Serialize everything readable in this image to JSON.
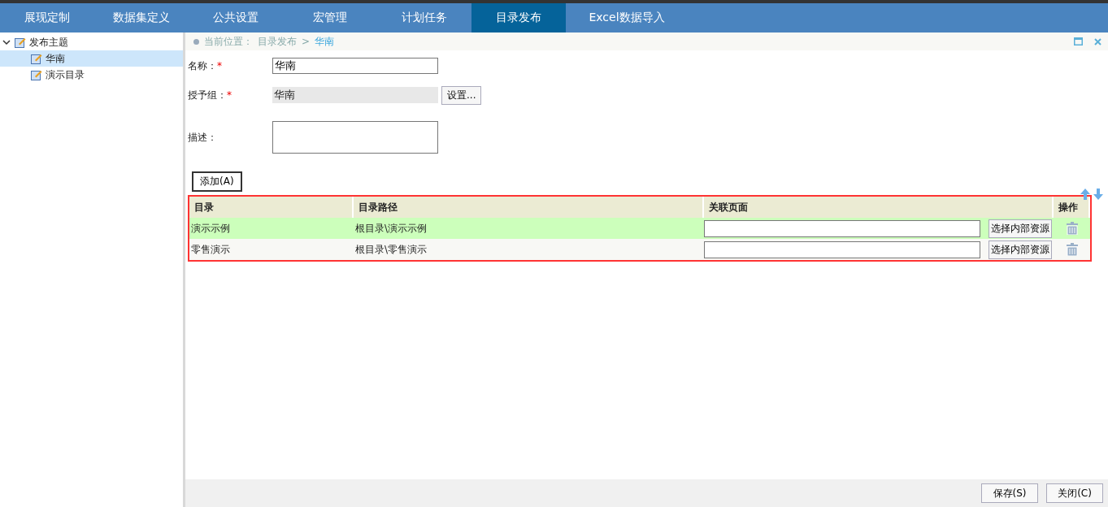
{
  "nav_tabs": [
    {
      "label": "展现定制",
      "selected": false
    },
    {
      "label": "数据集定义",
      "selected": false
    },
    {
      "label": "公共设置",
      "selected": false
    },
    {
      "label": "宏管理",
      "selected": false
    },
    {
      "label": "计划任务",
      "selected": false
    },
    {
      "label": "目录发布",
      "selected": true
    },
    {
      "label": "Excel数据导入",
      "selected": false
    }
  ],
  "tree": [
    {
      "label": "发布主题",
      "expanded": true,
      "selected": false,
      "children": [
        {
          "label": "华南",
          "selected": true
        },
        {
          "label": "演示目录",
          "selected": false
        }
      ]
    }
  ],
  "breadcrumb": {
    "prefix": "当前位置：",
    "items": [
      "目录发布",
      "华南"
    ],
    "separator": ">"
  },
  "form": {
    "name": {
      "label": "名称：",
      "required_mark": "*",
      "value": "华南"
    },
    "group": {
      "label": "授予组：",
      "required_mark": "*",
      "value": "华南",
      "button": "设置..."
    },
    "description": {
      "label": "描述："
    }
  },
  "add_button": "添加(A)",
  "table": {
    "columns": [
      "目录",
      "目录路径",
      "关联页面",
      "操作"
    ],
    "rows": [
      {
        "catalog": "演示示例",
        "path": "根目录\\演示示例",
        "selected": true,
        "button": "选择内部资源"
      },
      {
        "catalog": "零售演示",
        "path": "根目录\\零售演示",
        "selected": false,
        "button": "选择内部资源"
      }
    ]
  },
  "footer_buttons": [
    "保存(S)",
    "关闭(C)"
  ]
}
